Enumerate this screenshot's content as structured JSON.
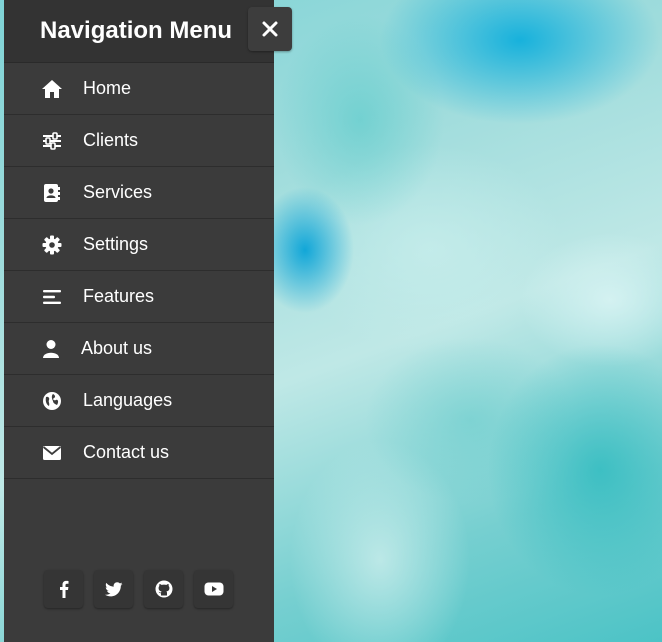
{
  "sidebar": {
    "title": "Navigation Menu",
    "close_icon": "close-icon",
    "items": [
      {
        "label": "Home",
        "icon": "home-icon"
      },
      {
        "label": "Clients",
        "icon": "sliders-icon"
      },
      {
        "label": "Services",
        "icon": "address-book-icon"
      },
      {
        "label": "Settings",
        "icon": "gear-icon"
      },
      {
        "label": "Features",
        "icon": "bars-icon"
      },
      {
        "label": "About us",
        "icon": "user-icon"
      },
      {
        "label": "Languages",
        "icon": "globe-icon"
      },
      {
        "label": "Contact us",
        "icon": "envelope-icon"
      }
    ],
    "social": [
      {
        "icon": "facebook-icon"
      },
      {
        "icon": "twitter-icon"
      },
      {
        "icon": "github-icon"
      },
      {
        "icon": "youtube-icon"
      }
    ]
  },
  "colors": {
    "sidebar_bg": "#3b3b3b",
    "header_bg": "#333333",
    "text": "#ffffff",
    "background_accent": "#4cc3c6"
  }
}
